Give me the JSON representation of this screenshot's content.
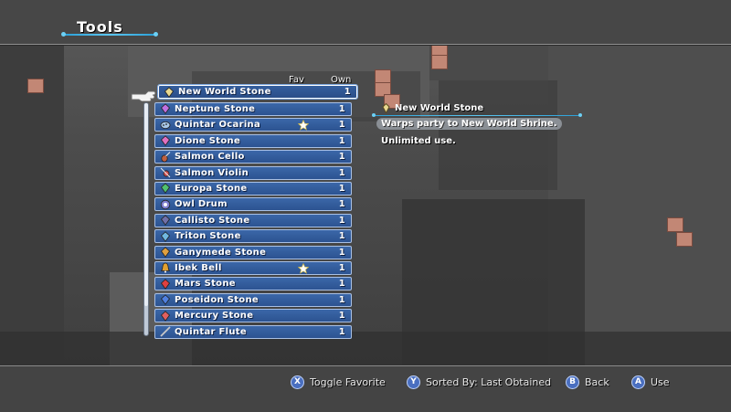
{
  "header": {
    "title": "Tools"
  },
  "columns": {
    "fav": "Fav",
    "own": "Own"
  },
  "items": [
    {
      "name": "New World Stone",
      "own": "1",
      "fav": false,
      "icon": "stone-icon",
      "color": "#e8d890",
      "selected": true
    },
    {
      "name": "Neptune Stone",
      "own": "1",
      "fav": false,
      "icon": "stone-icon",
      "color": "#c070e0"
    },
    {
      "name": "Quintar Ocarina",
      "own": "1",
      "fav": true,
      "icon": "ocarina-icon",
      "color": "#a8c8e8"
    },
    {
      "name": "Dione Stone",
      "own": "1",
      "fav": false,
      "icon": "stone-icon",
      "color": "#e070c0"
    },
    {
      "name": "Salmon Cello",
      "own": "1",
      "fav": false,
      "icon": "cello-icon",
      "color": "#c06040"
    },
    {
      "name": "Salmon Violin",
      "own": "1",
      "fav": false,
      "icon": "violin-icon",
      "color": "#d05050"
    },
    {
      "name": "Europa Stone",
      "own": "1",
      "fav": false,
      "icon": "stone-icon",
      "color": "#50c070"
    },
    {
      "name": "Owl Drum",
      "own": "1",
      "fav": false,
      "icon": "drum-icon",
      "color": "#8080d0"
    },
    {
      "name": "Callisto Stone",
      "own": "1",
      "fav": false,
      "icon": "stone-icon",
      "color": "#7070a8"
    },
    {
      "name": "Triton Stone",
      "own": "1",
      "fav": false,
      "icon": "stone-icon",
      "color": "#70b8e0"
    },
    {
      "name": "Ganymede Stone",
      "own": "1",
      "fav": false,
      "icon": "stone-icon",
      "color": "#e0a040"
    },
    {
      "name": "Ibek Bell",
      "own": "1",
      "fav": true,
      "icon": "bell-icon",
      "color": "#e0a030"
    },
    {
      "name": "Mars Stone",
      "own": "1",
      "fav": false,
      "icon": "stone-icon",
      "color": "#e04040"
    },
    {
      "name": "Poseidon Stone",
      "own": "1",
      "fav": false,
      "icon": "stone-icon",
      "color": "#5080e0"
    },
    {
      "name": "Mercury Stone",
      "own": "1",
      "fav": false,
      "icon": "stone-icon",
      "color": "#e06060"
    },
    {
      "name": "Quintar Flute",
      "own": "1",
      "fav": false,
      "icon": "flute-icon",
      "color": "#c8c8c8"
    }
  ],
  "detail": {
    "name": "New World Stone",
    "description": "Warps party to New World Shrine.",
    "note": "Unlimited use."
  },
  "footer": {
    "hints": [
      {
        "button": "X",
        "label": "Toggle Favorite",
        "icon": "x-button-icon"
      },
      {
        "button": "Y",
        "label": "Sorted By: Last Obtained",
        "icon": "y-button-icon"
      },
      {
        "button": "B",
        "label": "Back",
        "icon": "b-button-icon"
      },
      {
        "button": "A",
        "label": "Use",
        "icon": "a-button-icon"
      }
    ]
  },
  "colors": {
    "accent": "#2ba0d8",
    "row": "#2c5391",
    "row_border": "#a9c0e4"
  }
}
